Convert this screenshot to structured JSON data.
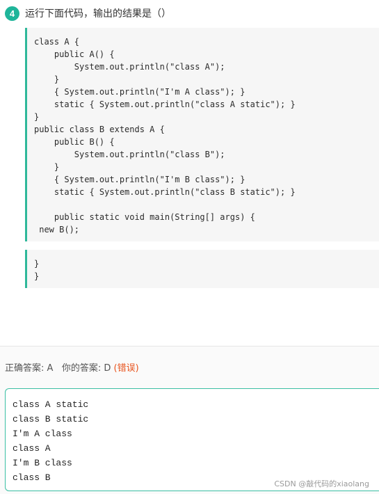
{
  "question": {
    "number": "4",
    "title": "运行下面代码，输出的结果是（）"
  },
  "code": {
    "main_lines": [
      "class A {",
      "    public A() {",
      "        System.out.println(\"class A\");",
      "    }",
      "    { System.out.println(\"I'm A class\"); }",
      "    static { System.out.println(\"class A static\"); }",
      "}",
      "public class B extends A {",
      "    public B() {",
      "        System.out.println(\"class B\");",
      "    }",
      "    { System.out.println(\"I'm B class\"); }",
      "    static { System.out.println(\"class B static\"); }",
      "",
      "    public static void main(String[] args) {",
      " new B();"
    ],
    "tail_lines": [
      "}",
      "}"
    ]
  },
  "answer": {
    "correct_label": "正确答案: ",
    "correct_value": "A",
    "yours_label": "你的答案: ",
    "yours_value": "D",
    "status": "(错误)"
  },
  "output": {
    "lines": [
      "class A static",
      "class B static",
      "I'm A class",
      "class A",
      "I'm B class",
      "class B"
    ]
  },
  "watermark": "CSDN @敲代码的xiaolang",
  "colors": {
    "accent": "#1fb59a",
    "error": "#e8541e"
  }
}
